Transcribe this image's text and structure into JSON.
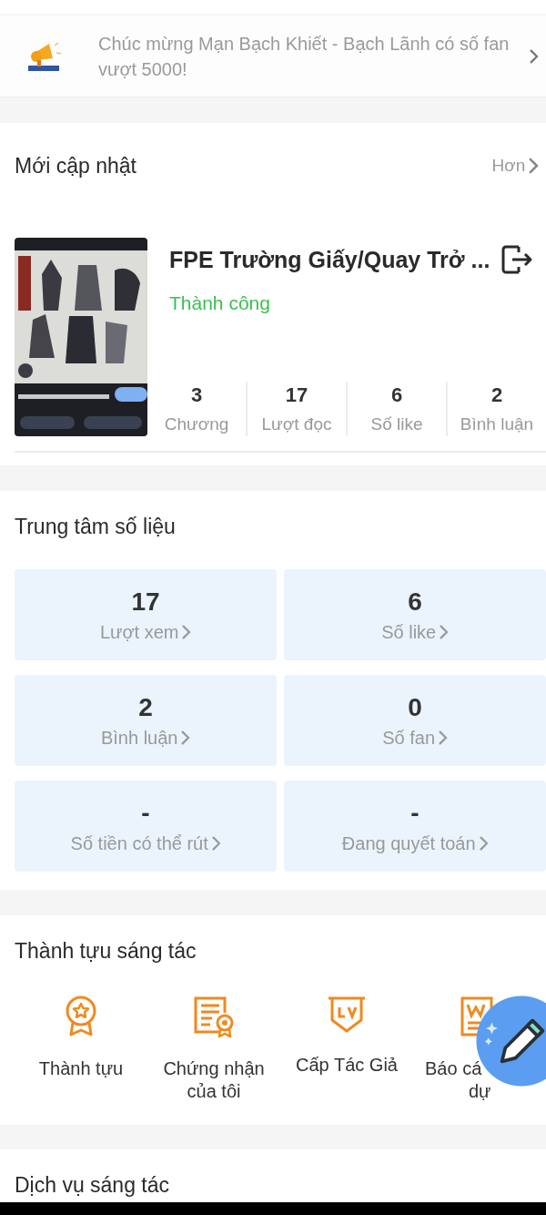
{
  "banner": {
    "message": "Chúc mừng Mạn Bạch Khiết - Bạch Lãnh có số fan vượt 5000!"
  },
  "recent": {
    "title": "Mới cập nhật",
    "more": "Hơn",
    "book": {
      "title": "FPE Trường Giấy/Quay Trở ...",
      "status": "Thành công",
      "stats": [
        {
          "value": "3",
          "label": "Chương"
        },
        {
          "value": "17",
          "label": "Lượt đọc"
        },
        {
          "value": "6",
          "label": "Số like"
        },
        {
          "value": "2",
          "label": "Bình luận"
        }
      ]
    }
  },
  "data_center": {
    "title": "Trung tâm số liệu",
    "tiles": [
      {
        "value": "17",
        "label": "Lượt xem"
      },
      {
        "value": "6",
        "label": "Số like"
      },
      {
        "value": "2",
        "label": "Bình luận"
      },
      {
        "value": "0",
        "label": "Số fan"
      },
      {
        "value": "-",
        "label": "Số tiền có thể rút"
      },
      {
        "value": "-",
        "label": "Đang quyết toán"
      }
    ]
  },
  "achievements": {
    "title": "Thành tựu sáng tác",
    "items": [
      {
        "kind": "medal",
        "lines": [
          "Thành tựu"
        ]
      },
      {
        "kind": "certificate",
        "lines": [
          "Chứng nhận",
          "của tôi"
        ]
      },
      {
        "kind": "level",
        "lines": [
          "Cấp Tác Giả"
        ]
      },
      {
        "kind": "report",
        "lines": [
          "Báo cá",
          "dự"
        ]
      }
    ]
  },
  "services": {
    "title": "Dịch vụ sáng tác"
  }
}
